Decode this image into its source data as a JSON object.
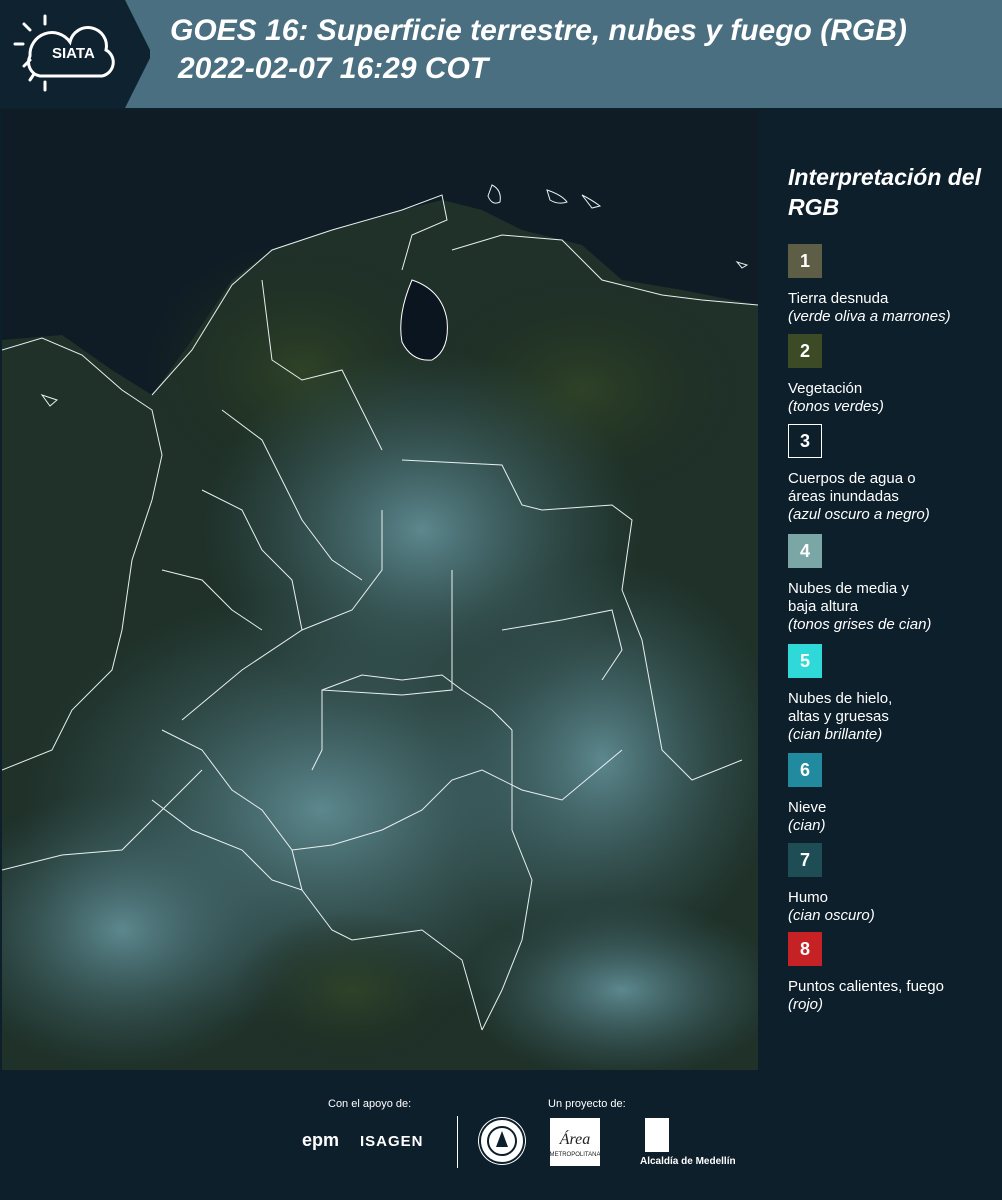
{
  "header": {
    "logo_text": "SIATA",
    "title_line1": "GOES 16: Superficie terrestre, nubes y fuego (RGB)",
    "title_line2": "2022-02-07 16:29 COT"
  },
  "legend": {
    "title": "Interpretación del RGB",
    "items": [
      {
        "num": "1",
        "color": "#5d5e45",
        "name": "Tierra desnuda",
        "desc": "(verde oliva a marrones)"
      },
      {
        "num": "2",
        "color": "#3c4a26",
        "name": "Vegetación",
        "desc": "(tonos verdes)"
      },
      {
        "num": "3",
        "color": "#0d1f2b",
        "name": "Cuerpos de agua o áreas inundadas",
        "desc": "(azul oscuro a negro)"
      },
      {
        "num": "4",
        "color": "#7aa6a6",
        "name": "Nubes de media y baja altura",
        "desc": "(tonos grises de cian)"
      },
      {
        "num": "5",
        "color": "#2fd9d9",
        "name": "Nubes de hielo, altas y gruesas",
        "desc": "(cian brillante)"
      },
      {
        "num": "6",
        "color": "#218a9e",
        "name": "Nieve",
        "desc": "(cian)"
      },
      {
        "num": "7",
        "color": "#1f4d55",
        "name": "Humo",
        "desc": "(cian oscuro)"
      },
      {
        "num": "8",
        "color": "#c62124",
        "name": "Puntos calientes, fuego",
        "desc": "(rojo)"
      }
    ]
  },
  "footer": {
    "support_label": "Con el apoyo de:",
    "project_label": "Un proyecto de:",
    "sponsor1": "epm",
    "sponsor2": "ISAGEN",
    "partner_area": "Área Metropolitana",
    "partner_alcaldia": "Alcaldía de Medellín"
  }
}
